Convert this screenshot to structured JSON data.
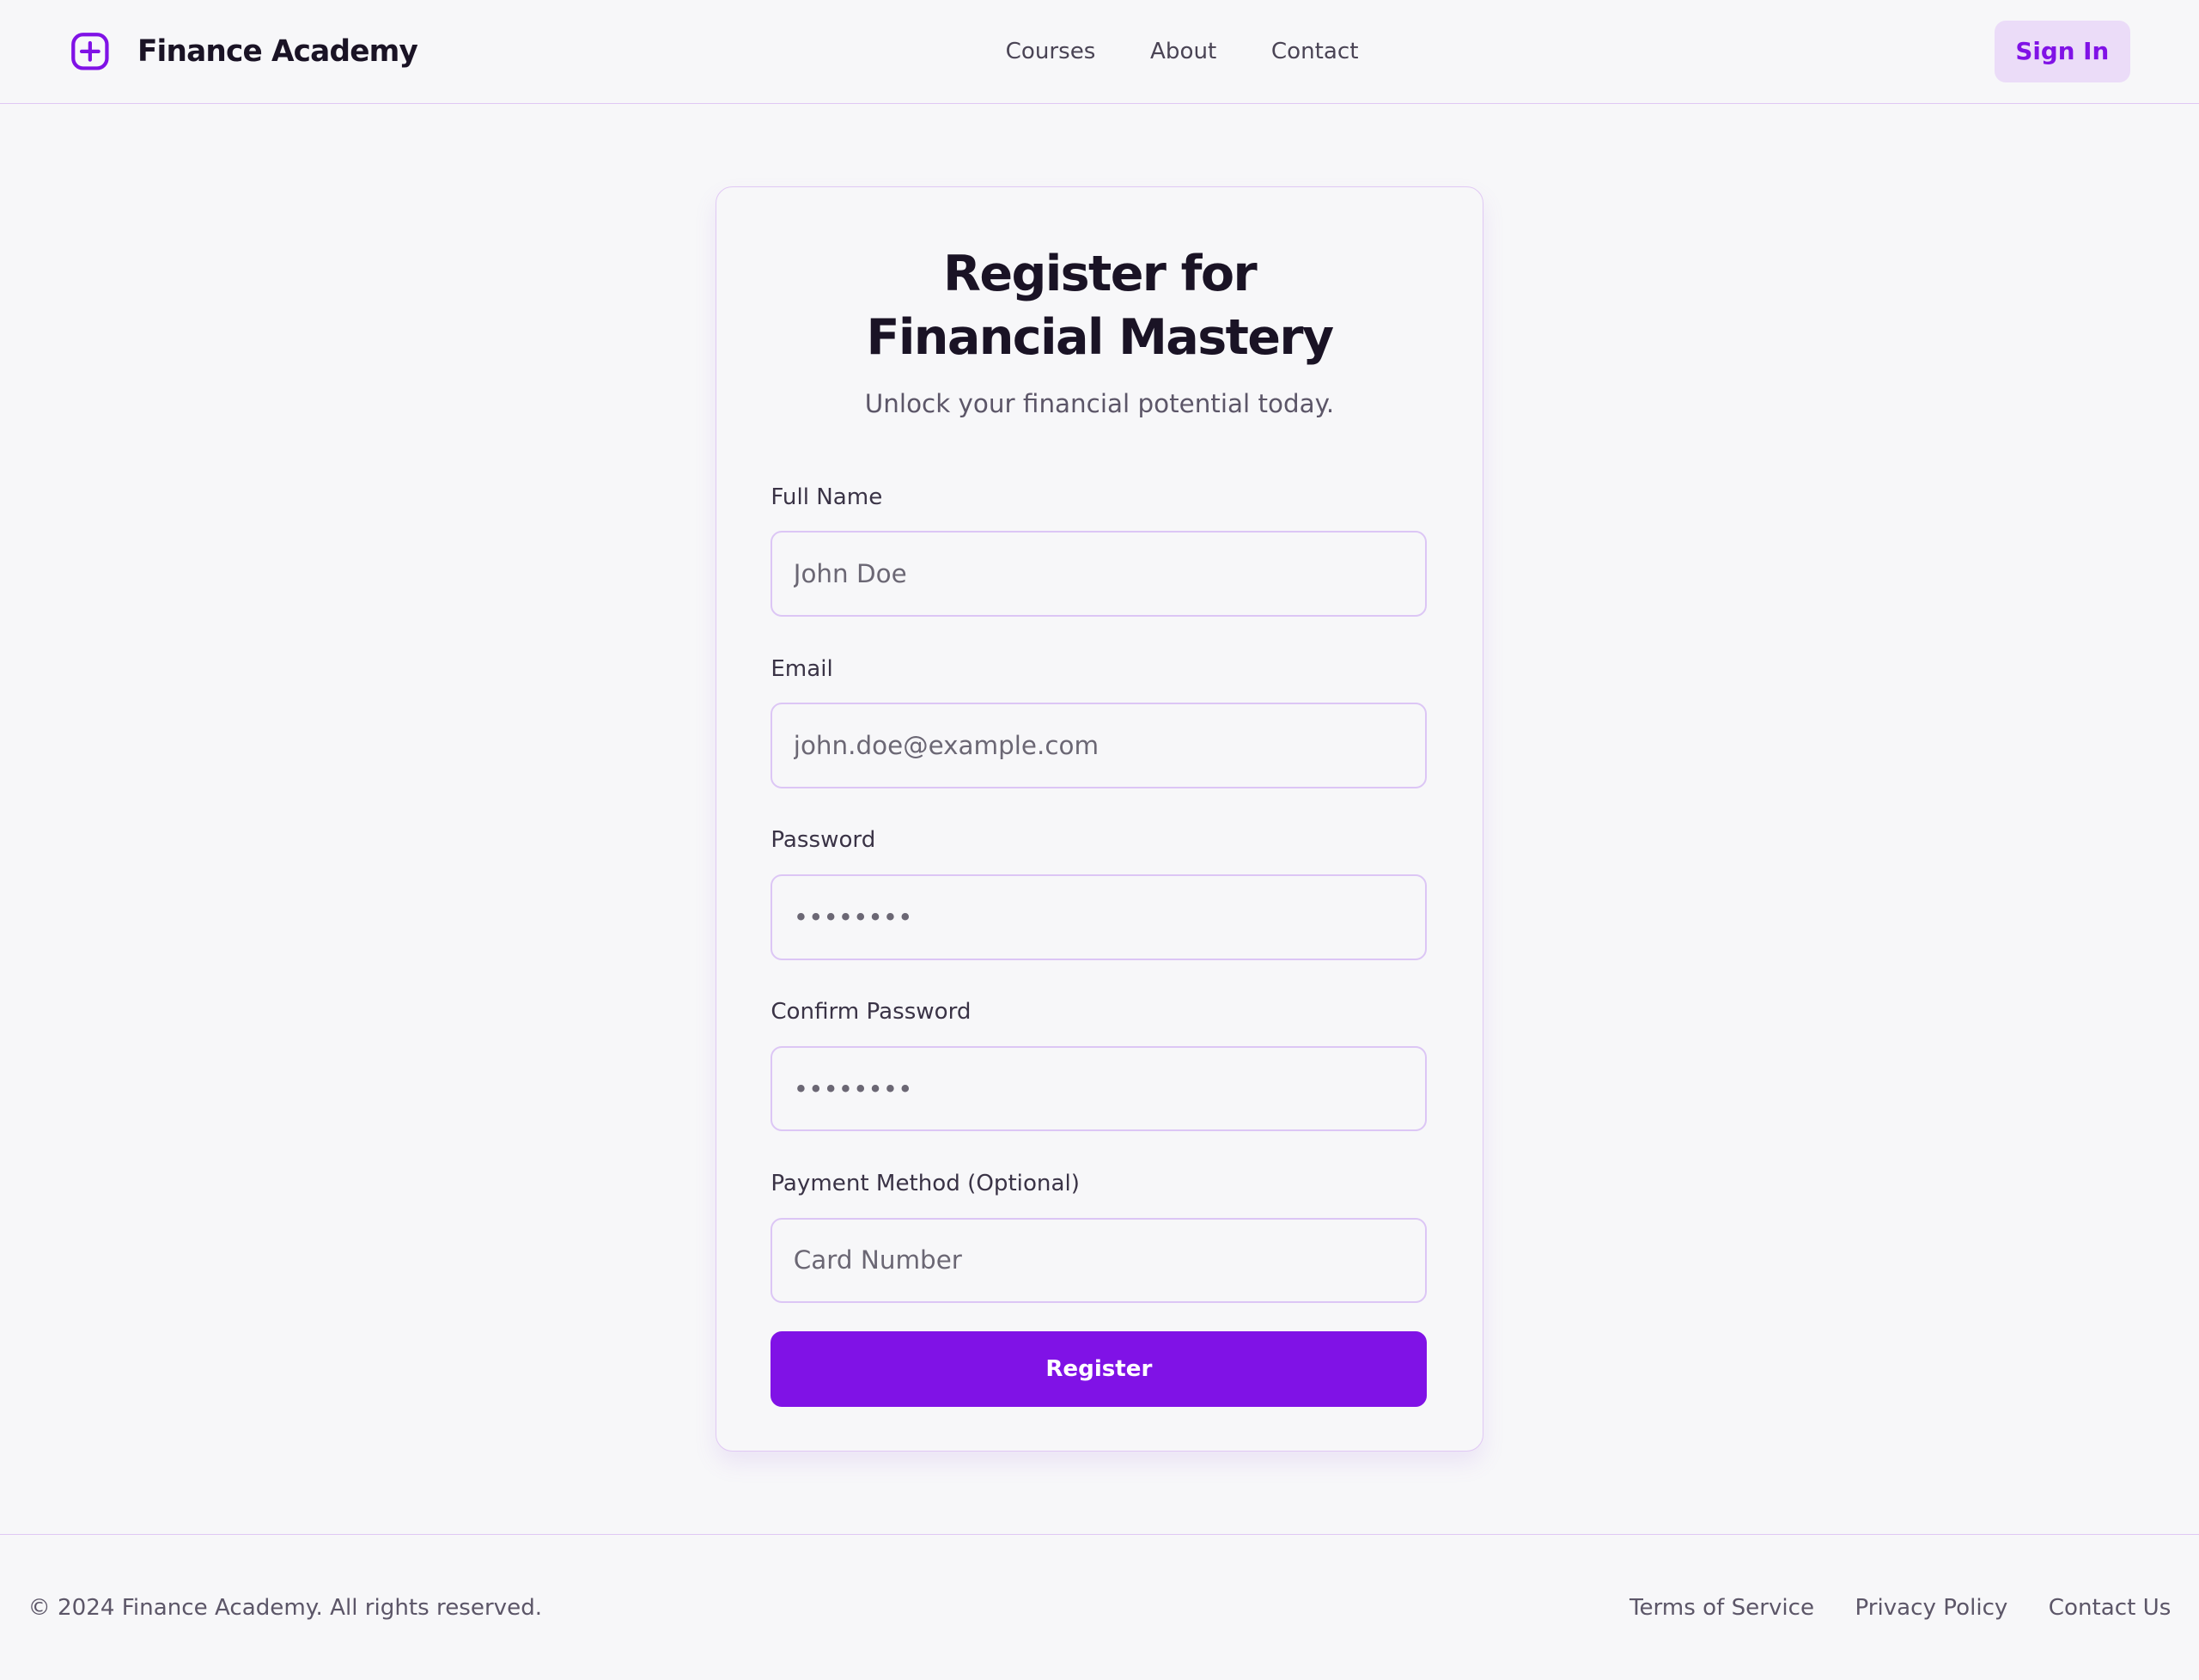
{
  "header": {
    "brand": "Finance Academy",
    "nav": [
      "Courses",
      "About",
      "Contact"
    ],
    "sign_in": "Sign In"
  },
  "form": {
    "title": "Register for Financial Mastery",
    "subtitle": "Unlock your financial potential today.",
    "fields": [
      {
        "label": "Full Name",
        "placeholder": "John Doe"
      },
      {
        "label": "Email",
        "placeholder": "john.doe@example.com"
      },
      {
        "label": "Password",
        "placeholder": "••••••••"
      },
      {
        "label": "Confirm Password",
        "placeholder": "••••••••"
      },
      {
        "label": "Payment Method (Optional)",
        "placeholder": "Card Number"
      }
    ],
    "submit": "Register"
  },
  "footer": {
    "copyright": "© 2024 Finance Academy. All rights reserved.",
    "links": [
      "Terms of Service",
      "Privacy Policy",
      "Contact Us"
    ]
  },
  "colors": {
    "accent": "#8012e6",
    "border": "#e0c8f4"
  }
}
